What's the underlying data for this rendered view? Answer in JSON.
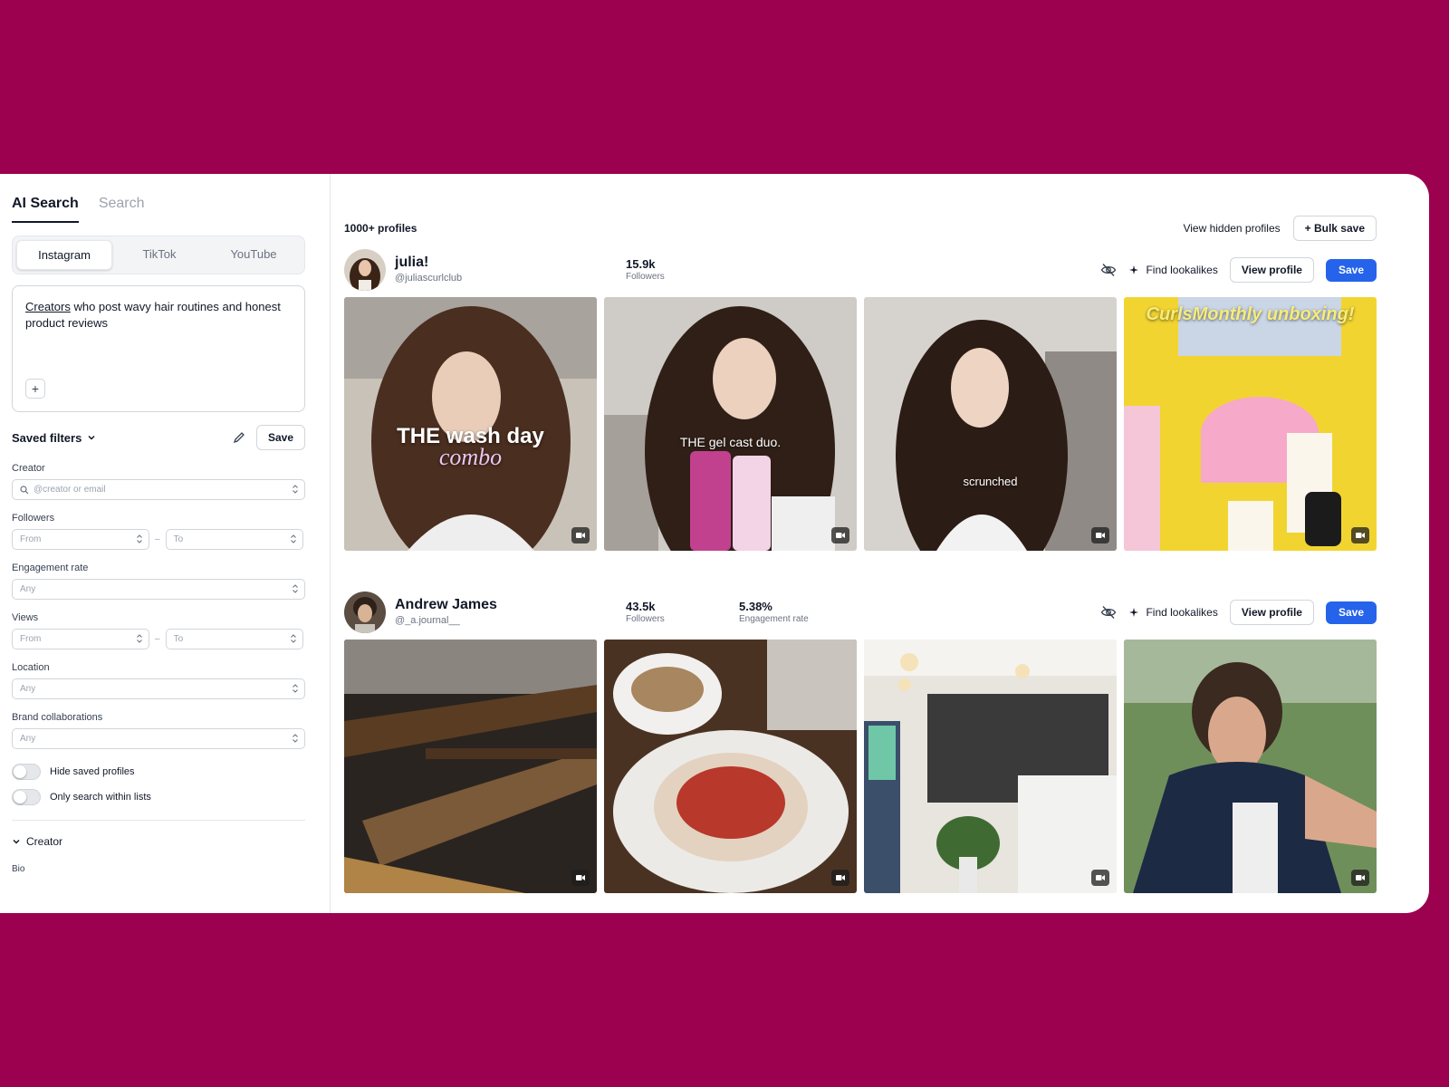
{
  "sidebar": {
    "mode_tabs": [
      "AI Search",
      "Search"
    ],
    "platforms": [
      "Instagram",
      "TikTok",
      "YouTube"
    ],
    "prompt_underlined": "Creators",
    "prompt_rest": " who post wavy hair routines and honest product reviews",
    "plus_label": "+",
    "saved_filters_label": "Saved filters",
    "save_label": "Save",
    "creator_label": "Creator",
    "creator_placeholder": "@creator or email",
    "followers_label": "Followers",
    "from": "From",
    "to": "To",
    "dash": "–",
    "engagement_label": "Engagement rate",
    "any": "Any",
    "views_label": "Views",
    "location_label": "Location",
    "brand_label": "Brand collaborations",
    "hide_saved": "Hide saved profiles",
    "only_lists": "Only search within lists",
    "creator_section": "Creator",
    "bio_label": "Bio"
  },
  "main": {
    "results_count": "1000+ profiles",
    "view_hidden": "View hidden profiles",
    "bulk_save": "+ Bulk save",
    "find_lookalikes": "Find lookalikes",
    "view_profile": "View profile",
    "save": "Save",
    "creators": [
      {
        "name": "julia!",
        "handle": "@juliascurlclub",
        "followers": "15.9k",
        "followers_label": "Followers",
        "captions": [
          "THE wash day",
          "combo",
          "THE gel cast duo.",
          "scrunched",
          "CurlsMonthly unboxing!"
        ]
      },
      {
        "name": "Andrew James",
        "handle": "@_a.journal__",
        "followers": "43.5k",
        "followers_label": "Followers",
        "engagement": "5.38%",
        "engagement_label": "Engagement rate"
      }
    ]
  },
  "colors": {
    "background": "#9c0150",
    "primary": "#2563eb"
  }
}
